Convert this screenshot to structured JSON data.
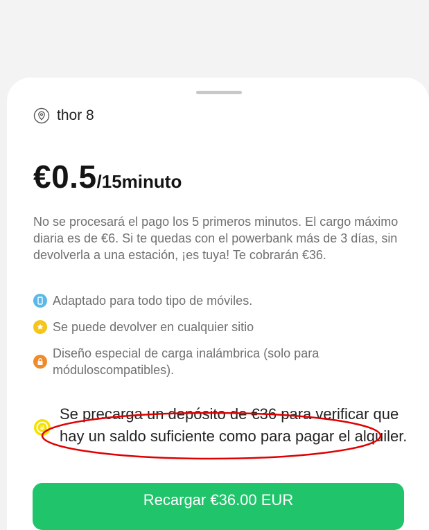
{
  "sheet": {
    "location_icon": "location-pin-icon",
    "location_name": "thor 8"
  },
  "price": {
    "amount": "€0.5",
    "unit": "/15minuto"
  },
  "description": "No se procesará el pago los 5 primeros minutos. El cargo máximo diaria es de €6. Si te quedas con el powerbank más de 3 días, sin devolverla a una estación, ¡es tuya! Te cobrarán €36.",
  "features": [
    {
      "icon": "phone-icon",
      "color": "#5bb8e8",
      "label": "Adaptado para todo tipo de móviles."
    },
    {
      "icon": "star-icon",
      "color": "#f5c518",
      "label": "Se puede devolver en cualquier sitio"
    },
    {
      "icon": "lock-icon",
      "color": "#f08a2b",
      "label": "Diseño especial de carga inalámbrica (solo para móduloscompatibles)."
    }
  ],
  "deposit": {
    "icon": "coin-icon",
    "color": "#f5e100",
    "text": "Se precarga un depósito de €36 para verificar que hay un saldo suficiente como para pagar el alquiler."
  },
  "button": {
    "label": "Recargar €36.00 EUR",
    "color": "#1fc46b"
  },
  "annotation": {
    "color": "#e00000"
  }
}
